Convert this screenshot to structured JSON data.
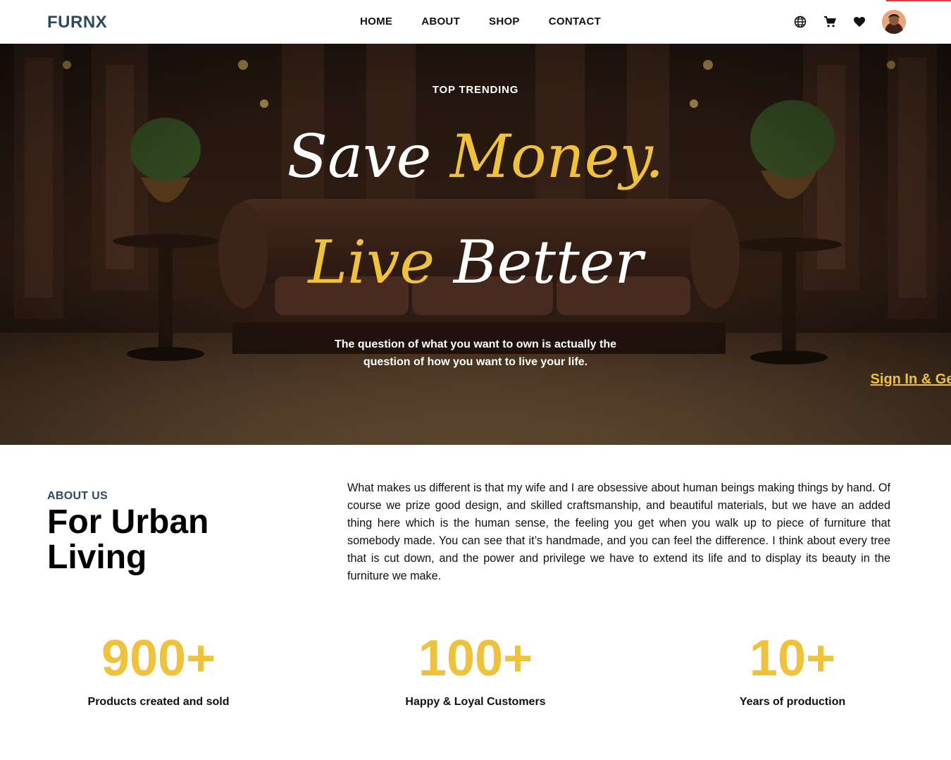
{
  "brand": "FURNX",
  "nav": [
    "HOME",
    "ABOUT",
    "SHOP",
    "CONTACT"
  ],
  "header_icons": [
    "globe-icon",
    "cart-icon",
    "heart-icon",
    "user-avatar"
  ],
  "hero": {
    "eyebrow": "TOP TRENDING",
    "line1_a": "Save",
    "line1_b": "Money.",
    "line2_a": "Live",
    "line2_b": "Better",
    "tagline": "The question of what you want to own is actually the question of how you want to live your life.",
    "cta": "Sign In & Get your Now!"
  },
  "about": {
    "label": "ABOUT US",
    "title": "For Urban Living",
    "body": "What makes us different is that my wife and I are obsessive about human beings making things by hand. Of course we prize good design, and skilled craftsmanship, and beautiful materials, but we have an added thing here which is the human sense, the feeling you get when you walk up to piece of furniture that somebody made. You can see that it’s handmade, and you can feel the difference. I think about every tree that is cut down, and the power and privilege we have to extend its life and to display its beauty in the furniture we make."
  },
  "stats": [
    {
      "value": "900+",
      "label": "Products created and sold"
    },
    {
      "value": "100+",
      "label": "Happy & Loyal Customers"
    },
    {
      "value": "10+",
      "label": "Years of production"
    }
  ],
  "colors": {
    "accent": "#f0c23c",
    "brand": "#2b4a60"
  }
}
